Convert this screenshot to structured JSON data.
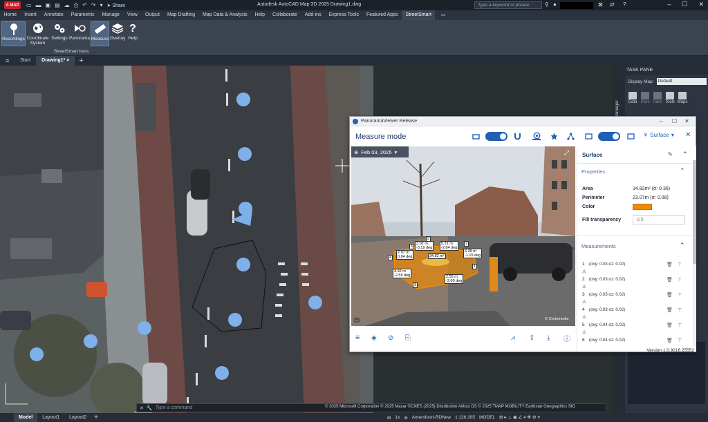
{
  "app": {
    "brand": "A MAP",
    "share_label": "Share",
    "title": "Autodesk AutoCAD Map 3D 2025   Drawing1.dwg",
    "search_placeholder": "Type a keyword or phrase"
  },
  "ribbon_tabs": [
    "Home",
    "Insert",
    "Annotate",
    "Parametric",
    "Manage",
    "View",
    "Output",
    "Map Drafting",
    "Map Data & Analysis",
    "Help",
    "Collaborate",
    "Add-ins",
    "Express Tools",
    "Featured Apps",
    "StreetSmart"
  ],
  "active_ribbon_tab": "StreetSmart",
  "ribbon_tools": [
    {
      "label": "Recordings",
      "icon": "recordings-icon"
    },
    {
      "label": "Coordinate System",
      "icon": "globe-icon"
    },
    {
      "label": "Settings",
      "icon": "gears-icon"
    },
    {
      "label": "Panorama",
      "icon": "panorama-icon"
    },
    {
      "label": "Measure",
      "icon": "ruler-icon"
    },
    {
      "label": "Overlay",
      "icon": "layers-icon"
    },
    {
      "label": "Help",
      "icon": "question-icon"
    }
  ],
  "ribbon_group_label": "StreetSmart tools",
  "doc_tabs": {
    "start": "Start",
    "active": "Drawing1*"
  },
  "command_line": {
    "placeholder": "Type a command"
  },
  "map_copyright": "© 2025 Microsoft Corporation © 2025 Maxar ©CNES (2025) Distribution Airbus DS © 2025 TMAP MOBILITY Earthstar Geographics  SIO",
  "task_pane": {
    "title": "TASK PANE",
    "side_label": "Display Manager",
    "display_map_label": "Display Map:",
    "display_map_value": "Default",
    "tools": [
      {
        "label": "Data",
        "enabled": true
      },
      {
        "label": "Style",
        "enabled": false
      },
      {
        "label": "Table",
        "enabled": false
      },
      {
        "label": "Tools",
        "enabled": true
      },
      {
        "label": "Maps",
        "enabled": true
      }
    ]
  },
  "status_bar": {
    "layout_tabs": [
      "Model",
      "Layout1",
      "Layout2"
    ],
    "active_layout": "Model",
    "coord_system": "Amersfoort-RDNew",
    "scale": "1:126.205",
    "space": "MODEL",
    "zoom": "1x"
  },
  "panorama": {
    "window_title": "PanoramaViewer Release",
    "mode_title": "Measure mode",
    "date": "Feb 03, 2025",
    "surface_dropdown": "Surface",
    "watermark": "© Cyclomedia",
    "version": "Version 1.0.9216.25552",
    "labels": [
      {
        "id": "l1",
        "text": "5.21 m\n-2.84 deg"
      },
      {
        "id": "l2",
        "text": "3.02 m\n-3.19 deg"
      },
      {
        "id": "l3",
        "text": "2.97 m\n0.04 deg"
      },
      {
        "id": "l4",
        "text": "34.82 m²"
      },
      {
        "id": "l5",
        "text": "6.39 m\n-1.15 deg"
      },
      {
        "id": "l6",
        "text": "3.92 m\n-2.59 deg"
      },
      {
        "id": "l7",
        "text": "2.55 m\n-2.60 deg"
      }
    ],
    "vertex_numbers": [
      "1",
      "2",
      "3",
      "4",
      "5",
      "6"
    ],
    "panel": {
      "title": "Surface",
      "properties_header": "Properties",
      "area_label": "Area",
      "area_value": "34.82m² (σ: 0.36)",
      "perimeter_label": "Perimeter",
      "perimeter_value": "23.07m (σ: 0.08)",
      "color_label": "Color",
      "color_value": "#f08a00",
      "fill_label": "Fill transparency",
      "fill_value": "0.5",
      "measurements_header": "Measurements",
      "measurements": [
        {
          "n": "1",
          "text": "(σxy: 0.03 σz: 0.02)"
        },
        {
          "n": "2",
          "text": "(σxy: 0.03 σz: 0.02)"
        },
        {
          "n": "3",
          "text": "(σxy: 0.03 σz: 0.02)"
        },
        {
          "n": "4",
          "text": "(σxy: 0.03 σz: 0.02)"
        },
        {
          "n": "5",
          "text": "(σxy: 0.04 σz: 0.02)"
        },
        {
          "n": "6",
          "text": "(σxy: 0.04 σz: 0.02)"
        }
      ]
    }
  },
  "colors": {
    "accent": "#1f5fb5",
    "measure_fill": "#f08a00",
    "recording_dot": "#7fb0ea",
    "ribbon": "#3b4350"
  }
}
